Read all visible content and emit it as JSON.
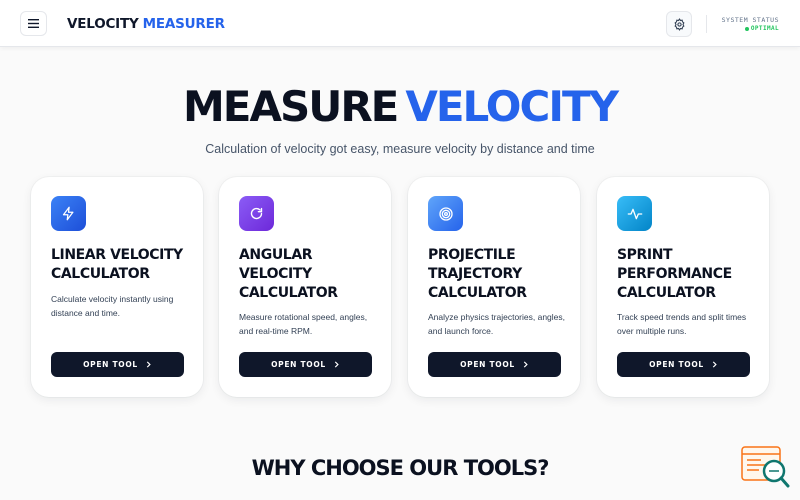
{
  "header": {
    "brand_part1": "VELOCITY",
    "brand_part2": "MEASURER",
    "status_label": "SYSTEM STATUS",
    "status_value": "OPTIMAL",
    "menu_icon": "hamburger-menu-icon",
    "settings_icon": "gear-icon"
  },
  "hero": {
    "title_part1": "MEASURE",
    "title_part2": "VELOCITY",
    "subtitle": "Calculation of velocity got easy, measure velocity by distance and time"
  },
  "cards": [
    {
      "icon": "lightning-bolt-icon",
      "icon_color": "#2563eb",
      "title": "LINEAR VELOCITY CALCULATOR",
      "description": "Calculate velocity instantly using distance and time.",
      "button_label": "OPEN TOOL"
    },
    {
      "icon": "rotate-arrow-icon",
      "icon_color": "#7c3aed",
      "title": "ANGULAR VELOCITY CALCULATOR",
      "description": "Measure rotational speed, angles, and real-time RPM.",
      "button_label": "OPEN TOOL"
    },
    {
      "icon": "target-icon",
      "icon_color": "#3b82f6",
      "title": "PROJECTILE TRAJECTORY CALCULATOR",
      "description": "Analyze physics trajectories, angles, and launch force.",
      "button_label": "OPEN TOOL"
    },
    {
      "icon": "pulse-line-icon",
      "icon_color": "#0ea5e9",
      "title": "SPRINT PERFORMANCE CALCULATOR",
      "description": "Track speed trends and split times over multiple runs.",
      "button_label": "OPEN TOOL"
    }
  ],
  "why": {
    "title": "WHY CHOOSE OUR TOOLS?"
  },
  "colors": {
    "accent": "#2563eb",
    "dark": "#0f172a",
    "status_green": "#22c55e"
  }
}
